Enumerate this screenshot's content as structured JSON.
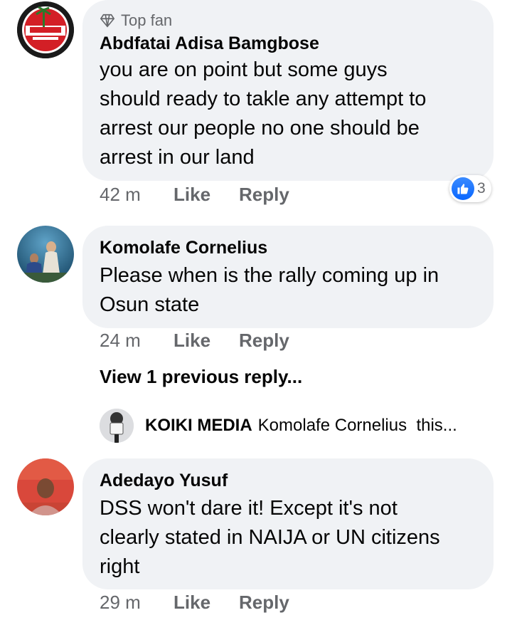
{
  "comments": [
    {
      "badge": "Top fan",
      "name": "Abdfatai Adisa Bamgbose",
      "lines": [
        "you are on point but some guys",
        "should ready to takle any attempt to",
        "arrest our people no one should be",
        "arrest in our land"
      ],
      "time": "42 m",
      "like": "Like",
      "reply": "Reply",
      "reaction_count": "3"
    },
    {
      "name": "Komolafe Cornelius",
      "lines": [
        "Please when is the rally coming up in",
        "Osun state"
      ],
      "time": "24 m",
      "like": "Like",
      "reply": "Reply"
    },
    {
      "name": "Adedayo Yusuf",
      "lines": [
        "DSS won't dare it! Except it's not",
        "clearly stated in NAIJA or UN citizens",
        "right"
      ],
      "time": "29 m",
      "like": "Like",
      "reply": "Reply"
    }
  ],
  "view_previous": "View 1 previous reply...",
  "reply_preview": {
    "name": "KOIKI MEDIA",
    "text": "Komolafe Cornelius  this..."
  },
  "colors": {
    "bubble": "#f0f2f5",
    "meta": "#65676b",
    "like_blue": "#0866ff"
  }
}
